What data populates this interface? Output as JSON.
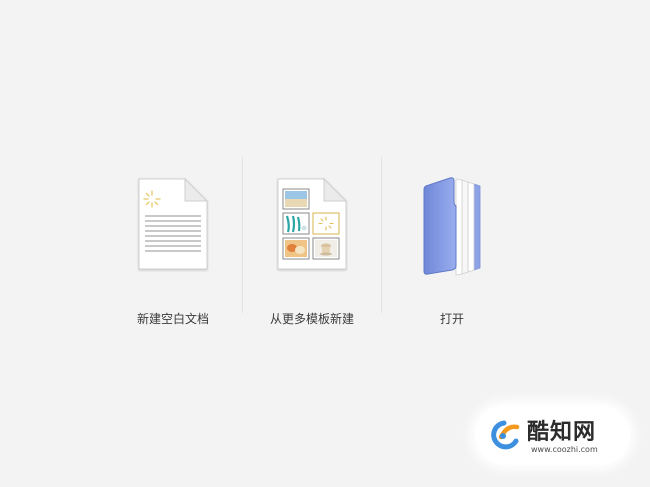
{
  "options": [
    {
      "label": "新建空白文档",
      "icon": "blank-document-icon"
    },
    {
      "label": "从更多模板新建",
      "icon": "template-document-icon"
    },
    {
      "label": "打开",
      "icon": "folder-icon"
    }
  ],
  "watermark": {
    "brand": "酷知网",
    "url": "www.coozhi.com",
    "logo_icon": "coozhi-logo-icon"
  },
  "colors": {
    "background": "#f3f3f3",
    "folder": "#7f97e0",
    "label_text": "#3c3c3c",
    "logo_blue": "#3d8fe0",
    "logo_orange": "#f39a1e"
  }
}
